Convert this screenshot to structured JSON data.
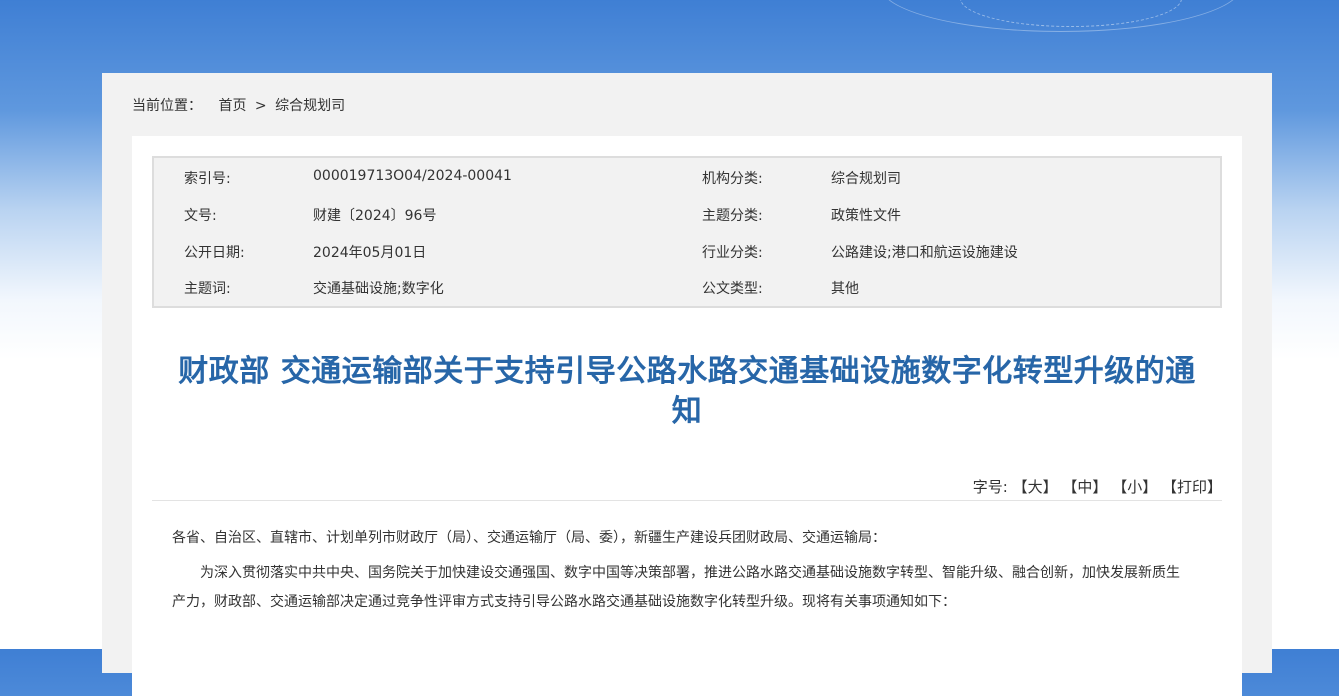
{
  "breadcrumb": {
    "label": "当前位置：",
    "home": "首页",
    "separator": ">",
    "current": "综合规划司"
  },
  "meta": {
    "index_label": "索引号:",
    "index_value": "000019713O04/2024-00041",
    "org_label": "机构分类:",
    "org_value": "综合规划司",
    "docno_label": "文号:",
    "docno_value": "财建〔2024〕96号",
    "topic_label": "主题分类:",
    "topic_value": "政策性文件",
    "date_label": "公开日期:",
    "date_value": "2024年05月01日",
    "industry_label": "行业分类:",
    "industry_value": "公路建设;港口和航运设施建设",
    "keywords_label": "主题词:",
    "keywords_value": "交通基础设施;数字化",
    "doctype_label": "公文类型:",
    "doctype_value": "其他"
  },
  "title_line1": "财政部 交通运输部关于支持引导公路水路交通基础设施数字化转型升级的通",
  "title_line2": "知",
  "fontsize": {
    "label": "字号:",
    "large": "【大】",
    "medium": "【中】",
    "small": "【小】",
    "print": "【打印】"
  },
  "body": {
    "recipients": "各省、自治区、直辖市、计划单列市财政厅（局）、交通运输厅（局、委），新疆生产建设兵团财政局、交通运输局：",
    "paragraph1": "为深入贯彻落实中共中央、国务院关于加快建设交通强国、数字中国等决策部署，推进公路水路交通基础设施数字转型、智能升级、融合创新，加快发展新质生产力，财政部、交通运输部决定通过竞争性评审方式支持引导公路水路交通基础设施数字化转型升级。现将有关事项通知如下："
  }
}
